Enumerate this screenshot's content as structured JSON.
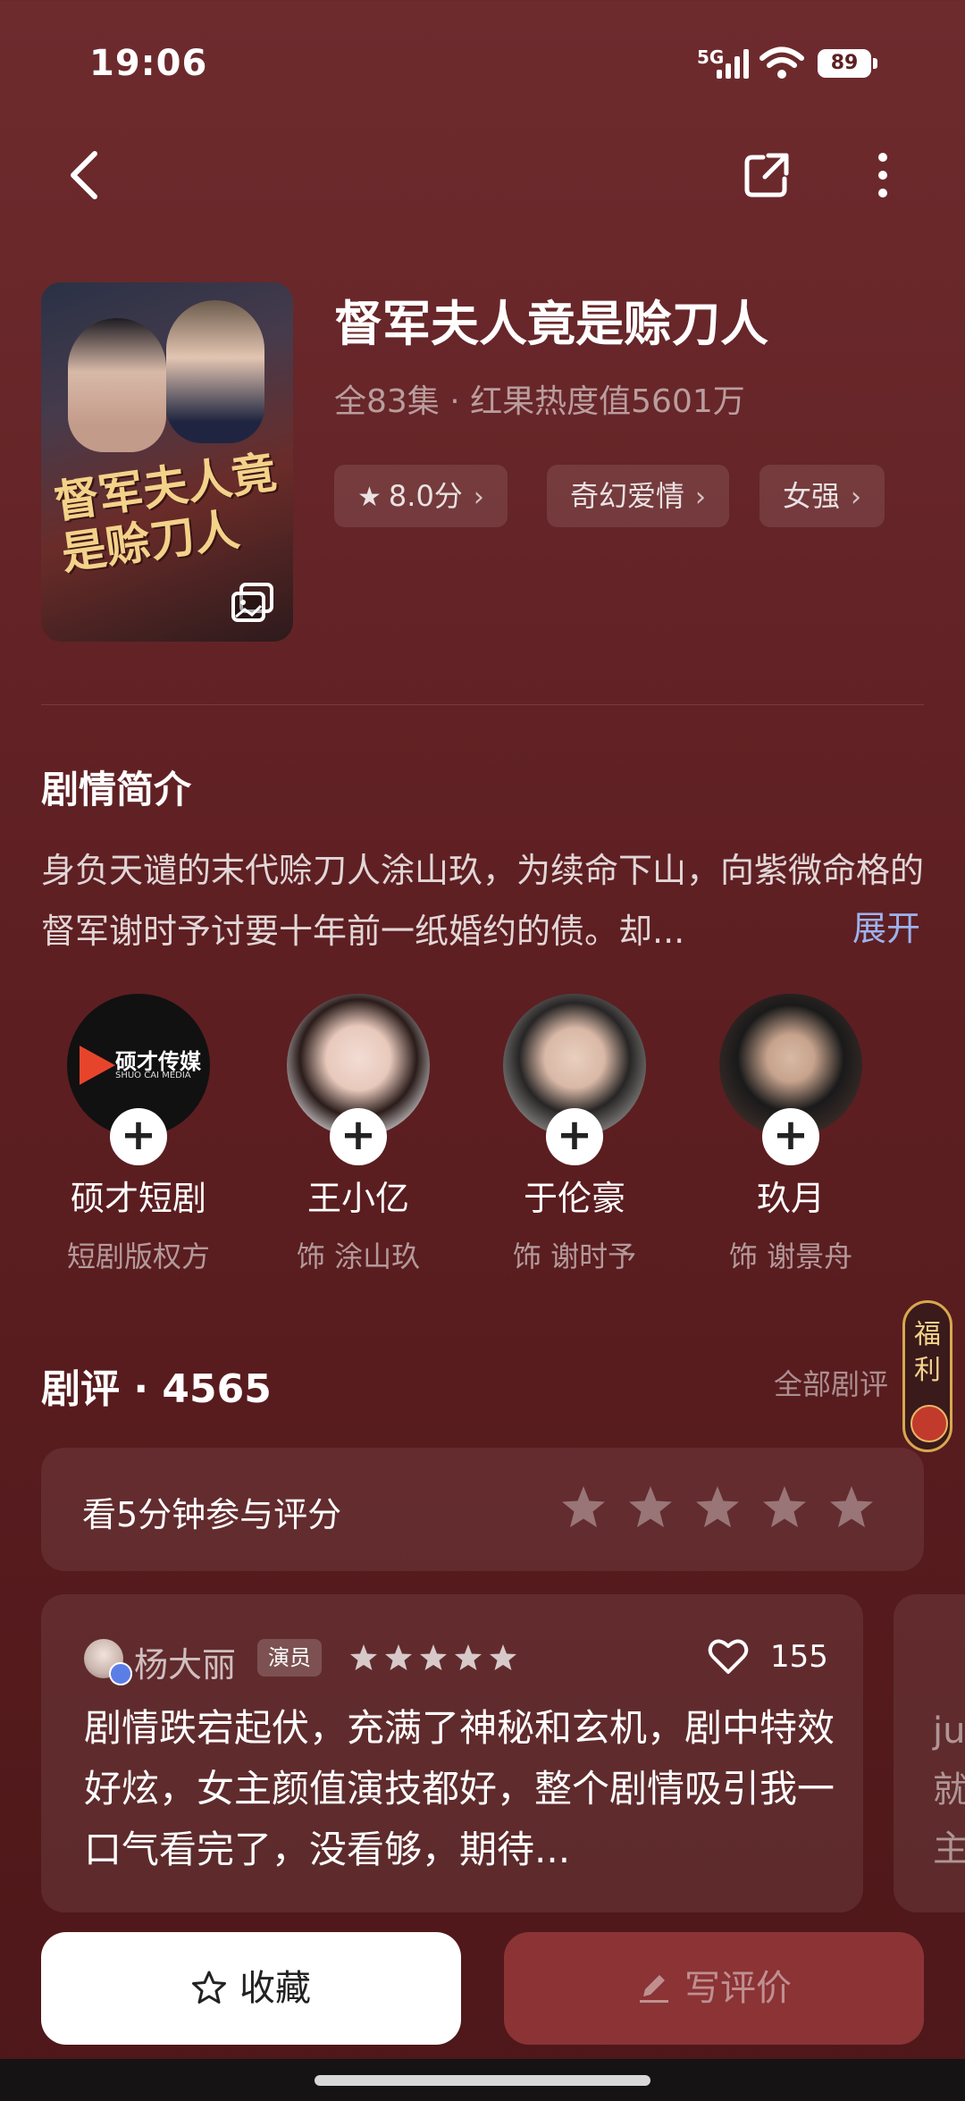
{
  "status": {
    "time": "19:06",
    "network": "5G",
    "battery": "89"
  },
  "drama": {
    "title": "督军夫人竟是赊刀人",
    "subtitle": "全83集 · 红果热度值5601万",
    "poster_title": "督军夫人竟是赊刀人",
    "tags": [
      {
        "label": "8.0分",
        "icon": "star-icon"
      },
      {
        "label": "奇幻爱情"
      },
      {
        "label": "女强"
      }
    ]
  },
  "synopsis": {
    "heading": "剧情简介",
    "text": "身负天谴的末代赊刀人涂山玖，为续命下山，向紫微命格的督军谢时予讨要十年前一纸婚约的债。却...",
    "expand": "展开"
  },
  "cast": [
    {
      "name": "硕才短剧",
      "role": "短剧版权方",
      "logo_text": "硕才传媒",
      "logo_sub": "SHUO CAI MEDIA"
    },
    {
      "name": "王小亿",
      "role": "饰 涂山玖"
    },
    {
      "name": "于伦豪",
      "role": "饰 谢时予"
    },
    {
      "name": "玖月",
      "role": "饰 谢景舟"
    }
  ],
  "fuli": "福利",
  "reviews": {
    "heading": "剧评 · 4565",
    "all_link": "全部剧评",
    "rate_prompt": "看5分钟参与评分",
    "items": [
      {
        "user": "杨大丽",
        "user_tag": "演员",
        "stars": 5,
        "likes": "155",
        "text": "剧情跌宕起伏，充满了神秘和玄机，剧中特效好炫，女主颜值演技都好，整个剧情吸引我一口气看完了，没看够，期待..."
      }
    ],
    "peek_text": "ju 就 主"
  },
  "actions": {
    "favorite": "收藏",
    "write_review": "写评价"
  },
  "colors": {
    "background": "#5e1f22",
    "accent_link": "#9db3f0",
    "write_button": "#8b3335"
  }
}
